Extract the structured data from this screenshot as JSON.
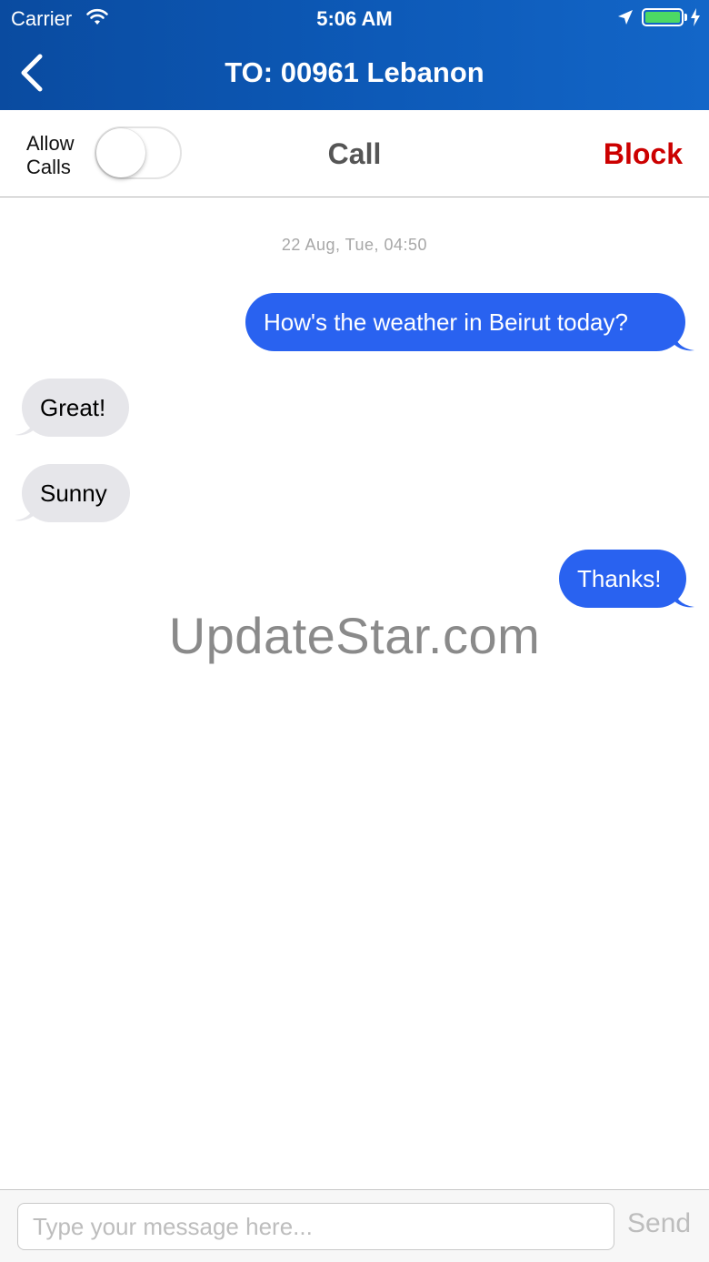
{
  "status_bar": {
    "carrier": "Carrier",
    "time": "5:06 AM",
    "battery_color": "#4cd964",
    "icons": [
      "wifi-icon",
      "location-arrow-icon",
      "battery-icon",
      "charging-bolt-icon"
    ]
  },
  "nav": {
    "title": "TO: 00961 Lebanon",
    "back_icon": "chevron-left-icon",
    "background_color": "#0d5ab8"
  },
  "toolbar": {
    "allow_calls_line1": "Allow",
    "allow_calls_line2": "Calls",
    "allow_calls_enabled": false,
    "call_label": "Call",
    "block_label": "Block",
    "block_color": "#cc0000"
  },
  "conversation": {
    "timestamp": "22 Aug, Tue, 04:50",
    "messages": [
      {
        "direction": "outgoing",
        "text": "How's the weather in Beirut today?"
      },
      {
        "direction": "incoming",
        "text": "Great!"
      },
      {
        "direction": "incoming",
        "text": "Sunny"
      },
      {
        "direction": "outgoing",
        "text": "Thanks!"
      }
    ],
    "outgoing_color": "#2962f0",
    "incoming_color": "#e6e6ea"
  },
  "watermark": "UpdateStar.com",
  "composer": {
    "placeholder": "Type your message here...",
    "value": "",
    "send_label": "Send"
  }
}
